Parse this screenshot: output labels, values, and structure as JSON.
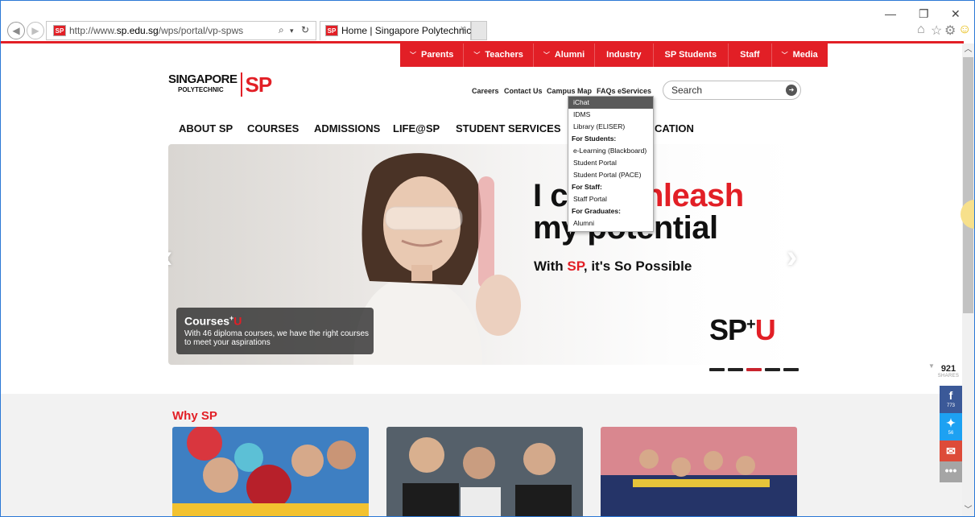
{
  "browser": {
    "address_url_prefix": "http://www.",
    "address_url_domain": "sp.edu.sg",
    "address_url_path": "/wps/portal/vp-spws",
    "tab_title": "Home | Singapore Polytechnic",
    "favicon_text": "SP",
    "search_glyph": "⌕",
    "refresh_glyph": "↻",
    "dropdown_glyph": "▾",
    "close_glyph": "×"
  },
  "top_menu": [
    {
      "label": "Parents",
      "dropdown": true
    },
    {
      "label": "Teachers",
      "dropdown": true
    },
    {
      "label": "Alumni",
      "dropdown": true
    },
    {
      "label": "Industry",
      "dropdown": false
    },
    {
      "label": "SP Students",
      "dropdown": false
    },
    {
      "label": "Staff",
      "dropdown": false
    },
    {
      "label": "Media",
      "dropdown": true
    }
  ],
  "logo": {
    "line1": "SINGAPORE",
    "line2": "POLYTECHNIC",
    "mark": "SP"
  },
  "utility_links": {
    "careers": "Careers",
    "contact": "Contact Us",
    "campus_map": "Campus Map",
    "faqs": "FAQs",
    "eservices": "eServices"
  },
  "search": {
    "placeholder": "Search"
  },
  "main_nav": {
    "about": "ABOUT SP",
    "courses": "COURSES",
    "admissions": "ADMISSIONS",
    "life": "LIFE@SP",
    "student_services": "STUDENT SERVICES",
    "continuing_edu_partial": "CATION"
  },
  "eservices_menu": {
    "items": {
      "ichat": "iChat",
      "idms": "IDMS",
      "library": "Library (ELISER)",
      "students_heading": "For Students:",
      "elearning": "e-Learning (Blackboard)",
      "student_portal": "Student Portal",
      "student_portal_pace": "Student Portal (PACE)",
      "staff_heading": "For Staff:",
      "staff_portal": "Staff Portal",
      "graduates_heading": "For Graduates:",
      "alumni": "Alumni"
    }
  },
  "hero": {
    "headline_line1_a": "I c",
    "headline_line1_b": "nleash",
    "headline_line2": "my potential",
    "tagline_a": "With ",
    "tagline_sp": "SP",
    "tagline_b": ", it's So Possible",
    "caption_title": "Courses",
    "caption_plus": "+",
    "caption_u": "U",
    "caption_text": "With 46 diploma courses, we have the right courses to meet your aspirations",
    "brand_sp": "SP",
    "brand_plus": "+",
    "brand_u": "U",
    "slides_total": 5,
    "slide_active": 3
  },
  "why_sp": {
    "heading": "Why SP"
  },
  "share": {
    "total": "921",
    "total_label": "SHARES",
    "facebook_count": "773",
    "twitter_count": "56"
  },
  "colors": {
    "brand_red": "#e21f26",
    "facebook": "#3b5998",
    "twitter": "#1da1f2",
    "email": "#dd4b39",
    "more": "#a5a5a5"
  }
}
